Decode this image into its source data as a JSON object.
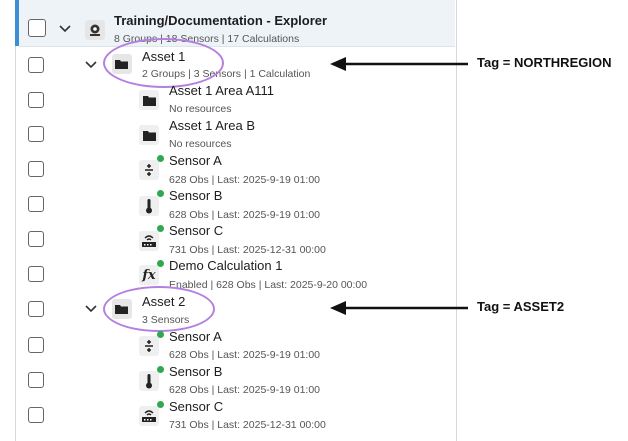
{
  "root": {
    "title": "Training/Documentation - Explorer",
    "summary": "8 Groups | 18 Sensors | 17 Calculations",
    "icon": "network-gear-icon"
  },
  "items": [
    {
      "title": "Asset 1",
      "summary": "2 Groups | 3 Sensors | 1 Calculation",
      "icon": "folder-open-icon"
    },
    {
      "title": "Asset 1 Area A111",
      "summary": "No resources",
      "icon": "folder-icon"
    },
    {
      "title": "Asset 1 Area B",
      "summary": "No resources",
      "icon": "folder-icon"
    },
    {
      "title": "Sensor A",
      "summary": "628 Obs | Last: 2025-9-19 01:00",
      "icon": "plus-minus-icon"
    },
    {
      "title": "Sensor B",
      "summary": "628 Obs | Last: 2025-9-19 01:00",
      "icon": "thermometer-icon"
    },
    {
      "title": "Sensor C",
      "summary": "731 Obs | Last: 2025-12-31 00:00",
      "icon": "router-icon"
    },
    {
      "title": "Demo Calculation 1",
      "summary": "Enabled | 628 Obs | Last: 2025-9-20 00:00",
      "icon": "function-icon"
    },
    {
      "title": "Asset 2",
      "summary": "3 Sensors",
      "icon": "folder-open-icon"
    },
    {
      "title": "Sensor A",
      "summary": "628 Obs | Last: 2025-9-19 01:00",
      "icon": "plus-minus-icon"
    },
    {
      "title": "Sensor B",
      "summary": "628 Obs | Last: 2025-9-19 01:00",
      "icon": "thermometer-icon"
    },
    {
      "title": "Sensor C",
      "summary": "731 Obs | Last: 2025-12-31 00:00",
      "icon": "router-icon"
    }
  ],
  "annotations": [
    {
      "label": "Tag = NORTHREGION"
    },
    {
      "label": "Tag = ASSET2"
    }
  ],
  "colors": {
    "highlight": "#b57fe0",
    "status_ok": "#2fa84f",
    "selected_bar": "#3a8fd6"
  }
}
